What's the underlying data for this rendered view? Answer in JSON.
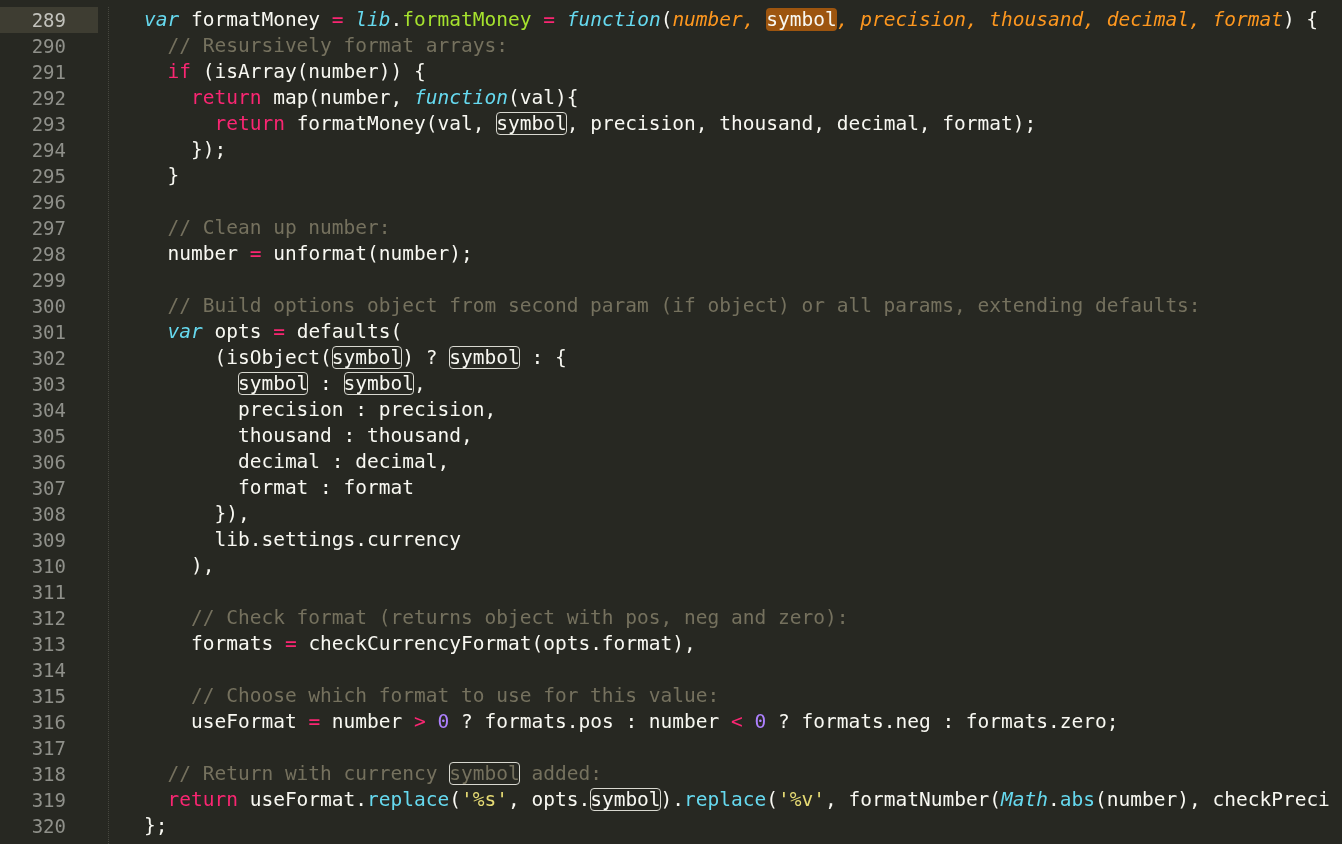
{
  "editor": {
    "lines": [
      {
        "number": "289",
        "current": true,
        "tokens": [
          {
            "kind": "storage",
            "text": "var"
          },
          {
            "kind": "plain",
            "text": " formatMoney "
          },
          {
            "kind": "operator",
            "text": "= "
          },
          {
            "kind": "storage",
            "text": "lib"
          },
          {
            "kind": "plain",
            "text": "."
          },
          {
            "kind": "entity",
            "text": "formatMoney"
          },
          {
            "kind": "operator",
            "text": " = "
          },
          {
            "kind": "storage",
            "text": "function"
          },
          {
            "kind": "plain",
            "text": "("
          },
          {
            "kind": "param",
            "text": "number, "
          },
          {
            "kind": "selection",
            "text": "symbol"
          },
          {
            "kind": "param",
            "text": ", precision, thousand, decimal, format"
          },
          {
            "kind": "plain",
            "text": ") {"
          }
        ]
      },
      {
        "number": "290",
        "current": false,
        "tokens": [
          {
            "kind": "comment",
            "text": "  // Resursively format arrays:"
          }
        ]
      },
      {
        "number": "291",
        "current": false,
        "tokens": [
          {
            "kind": "keyword",
            "text": "  if"
          },
          {
            "kind": "plain",
            "text": " (isArray(number)) {"
          }
        ]
      },
      {
        "number": "292",
        "current": false,
        "tokens": [
          {
            "kind": "keyword",
            "text": "    return"
          },
          {
            "kind": "plain",
            "text": " map(number, "
          },
          {
            "kind": "storage",
            "text": "function"
          },
          {
            "kind": "plain",
            "text": "(val){"
          }
        ]
      },
      {
        "number": "293",
        "current": false,
        "tokens": [
          {
            "kind": "keyword",
            "text": "      return"
          },
          {
            "kind": "plain",
            "text": " formatMoney(val, "
          },
          {
            "kind": "match",
            "text": "symbol"
          },
          {
            "kind": "plain",
            "text": ", precision, thousand, decimal, format);"
          }
        ]
      },
      {
        "number": "294",
        "current": false,
        "tokens": [
          {
            "kind": "plain",
            "text": "    });"
          }
        ]
      },
      {
        "number": "295",
        "current": false,
        "tokens": [
          {
            "kind": "plain",
            "text": "  }"
          }
        ]
      },
      {
        "number": "296",
        "current": false
      },
      {
        "number": "297",
        "current": false,
        "tokens": [
          {
            "kind": "comment",
            "text": "  // Clean up number:"
          }
        ]
      },
      {
        "number": "298",
        "current": false,
        "tokens": [
          {
            "kind": "plain",
            "text": "  number "
          },
          {
            "kind": "operator",
            "text": "= "
          },
          {
            "kind": "plain",
            "text": "unformat(number);"
          }
        ]
      },
      {
        "number": "299",
        "current": false
      },
      {
        "number": "300",
        "current": false,
        "tokens": [
          {
            "kind": "comment",
            "text": "  // Build options object from second param (if object) or all params, extending defaults:"
          }
        ]
      },
      {
        "number": "301",
        "current": false,
        "tokens": [
          {
            "kind": "storage",
            "text": "  var"
          },
          {
            "kind": "plain",
            "text": " opts "
          },
          {
            "kind": "operator",
            "text": "= "
          },
          {
            "kind": "plain",
            "text": "defaults("
          }
        ]
      },
      {
        "number": "302",
        "current": false,
        "tokens": [
          {
            "kind": "plain",
            "text": "      (isObject("
          },
          {
            "kind": "match",
            "text": "symbol"
          },
          {
            "kind": "plain",
            "text": ") ? "
          },
          {
            "kind": "match",
            "text": "symbol"
          },
          {
            "kind": "plain",
            "text": " : {"
          }
        ]
      },
      {
        "number": "303",
        "current": false,
        "tokens": [
          {
            "kind": "indentmatch",
            "text": "symbol"
          },
          {
            "kind": "plain",
            "text": " : "
          },
          {
            "kind": "match",
            "text": "symbol"
          },
          {
            "kind": "plain",
            "text": ","
          }
        ]
      },
      {
        "number": "304",
        "current": false,
        "tokens": [
          {
            "kind": "plain",
            "text": "        precision : precision,"
          }
        ]
      },
      {
        "number": "305",
        "current": false,
        "tokens": [
          {
            "kind": "plain",
            "text": "        thousand : thousand,"
          }
        ]
      },
      {
        "number": "306",
        "current": false,
        "tokens": [
          {
            "kind": "plain",
            "text": "        decimal : decimal,"
          }
        ]
      },
      {
        "number": "307",
        "current": false,
        "tokens": [
          {
            "kind": "plain",
            "text": "        format : format"
          }
        ]
      },
      {
        "number": "308",
        "current": false,
        "tokens": [
          {
            "kind": "plain",
            "text": "      }),"
          }
        ]
      },
      {
        "number": "309",
        "current": false,
        "tokens": [
          {
            "kind": "plain",
            "text": "      lib.settings.currency"
          }
        ]
      },
      {
        "number": "310",
        "current": false,
        "tokens": [
          {
            "kind": "plain",
            "text": "    ),"
          }
        ]
      },
      {
        "number": "311",
        "current": false
      },
      {
        "number": "312",
        "current": false,
        "tokens": [
          {
            "kind": "comment",
            "text": "    // Check format (returns object with pos, neg and zero):"
          }
        ]
      },
      {
        "number": "313",
        "current": false,
        "tokens": [
          {
            "kind": "plain",
            "text": "    formats "
          },
          {
            "kind": "operator",
            "text": "= "
          },
          {
            "kind": "plain",
            "text": "checkCurrencyFormat(opts.format),"
          }
        ]
      },
      {
        "number": "314",
        "current": false
      },
      {
        "number": "315",
        "current": false,
        "tokens": [
          {
            "kind": "comment",
            "text": "    // Choose which format to use for this value:"
          }
        ]
      },
      {
        "number": "316",
        "current": false,
        "tokens": [
          {
            "kind": "plain",
            "text": "    useFormat "
          },
          {
            "kind": "operator",
            "text": "= "
          },
          {
            "kind": "plain",
            "text": "number "
          },
          {
            "kind": "operator",
            "text": "> "
          },
          {
            "kind": "number",
            "text": "0"
          },
          {
            "kind": "plain",
            "text": " ? formats.pos : number "
          },
          {
            "kind": "operator",
            "text": "< "
          },
          {
            "kind": "number",
            "text": "0"
          },
          {
            "kind": "plain",
            "text": " ? formats.neg : formats.zero;"
          }
        ]
      },
      {
        "number": "317",
        "current": false
      },
      {
        "number": "318",
        "current": false,
        "tokens": [
          {
            "kind": "comment",
            "text": "  // Return with currency "
          },
          {
            "kind": "commentmatch",
            "text": "symbol"
          },
          {
            "kind": "comment",
            "text": " added:"
          }
        ]
      },
      {
        "number": "319",
        "current": false,
        "tokens": [
          {
            "kind": "keyword",
            "text": "  return"
          },
          {
            "kind": "plain",
            "text": " useFormat."
          },
          {
            "kind": "support",
            "text": "replace"
          },
          {
            "kind": "plain",
            "text": "("
          },
          {
            "kind": "string",
            "text": "'%s'"
          },
          {
            "kind": "plain",
            "text": ", opts."
          },
          {
            "kind": "match",
            "text": "symbol"
          },
          {
            "kind": "plain",
            "text": ")."
          },
          {
            "kind": "support",
            "text": "replace"
          },
          {
            "kind": "plain",
            "text": "("
          },
          {
            "kind": "string",
            "text": "'%v'"
          },
          {
            "kind": "plain",
            "text": ", formatNumber("
          },
          {
            "kind": "storage",
            "text": "Math"
          },
          {
            "kind": "plain",
            "text": "."
          },
          {
            "kind": "support",
            "text": "abs"
          },
          {
            "kind": "plain",
            "text": "(number), checkPreci"
          }
        ]
      },
      {
        "number": "320",
        "current": false,
        "tokens": [
          {
            "kind": "plain",
            "text": "};"
          }
        ]
      }
    ]
  }
}
